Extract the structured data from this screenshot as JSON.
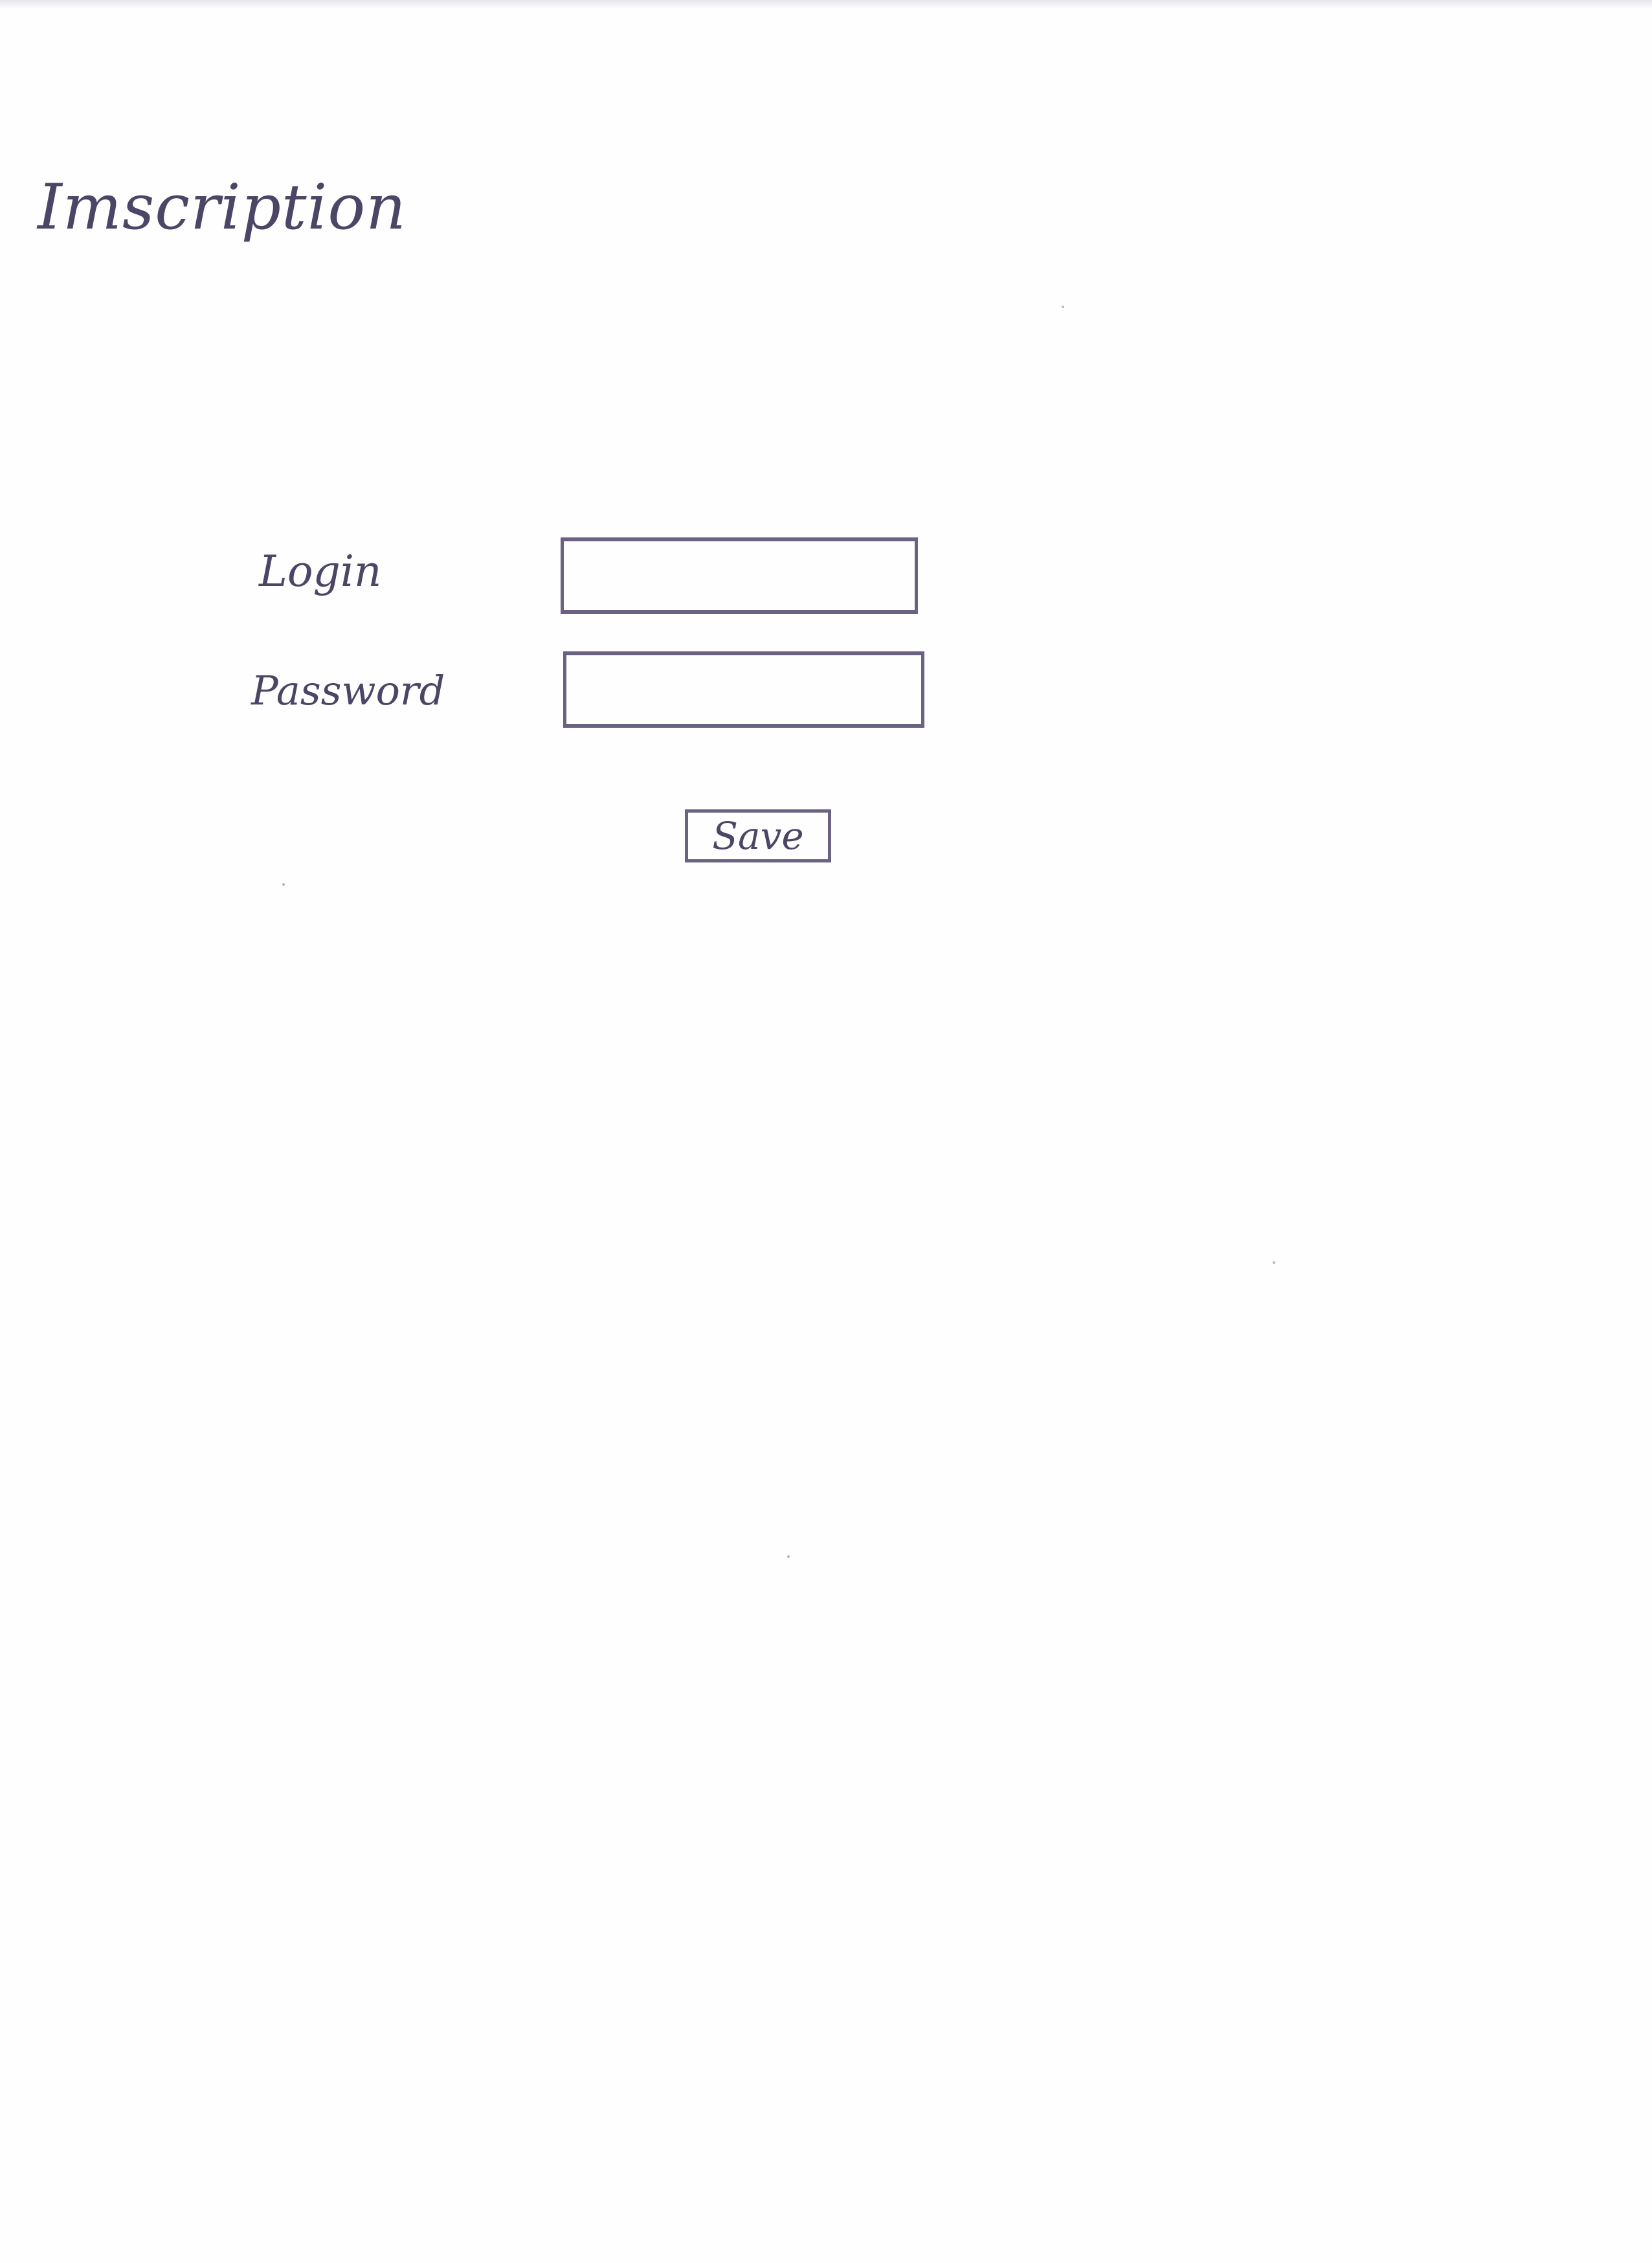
{
  "page": {
    "title": "Imscription"
  },
  "form": {
    "login_label": "Login",
    "login_value": "",
    "password_label": "Password",
    "password_value": "",
    "save_label": "Save"
  },
  "colors": {
    "ink": "#4d4566",
    "paper": "#fefefe"
  }
}
